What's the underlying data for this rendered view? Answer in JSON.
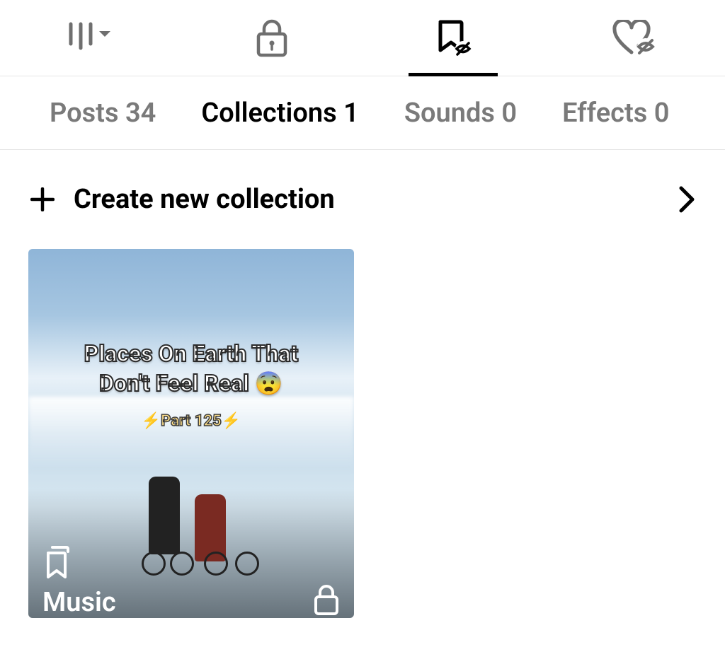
{
  "top_tabs": {
    "grid": "grid",
    "lock": "private",
    "bookmark": "saved",
    "heart": "liked",
    "active_index": 2
  },
  "sub_tabs": {
    "items": [
      {
        "label": "Posts",
        "count": "34"
      },
      {
        "label": "Collections",
        "count": "1"
      },
      {
        "label": "Sounds",
        "count": "0"
      },
      {
        "label": "Effects",
        "count": "0"
      }
    ],
    "active_index": 1
  },
  "create_row": {
    "label": "Create new collection"
  },
  "collections": [
    {
      "title": "Music",
      "is_private": true,
      "thumb_text_line1": "Places On Earth That",
      "thumb_text_line2": "Don't Feel Real 😨",
      "thumb_subtext": "⚡Part 125⚡"
    }
  ]
}
